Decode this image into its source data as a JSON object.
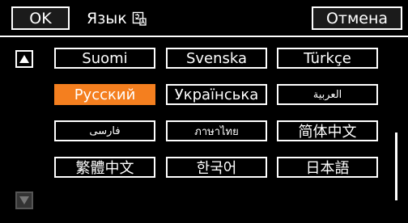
{
  "header": {
    "ok_label": "OK",
    "title": "Язык",
    "title_icon": "language-book-icon",
    "cancel_label": "Отмена"
  },
  "scroll": {
    "up_icon": "scroll-up-arrow-icon",
    "down_icon": "scroll-down-arrow-icon",
    "position": 1.0
  },
  "languages": [
    {
      "label": "Suomi",
      "selected": false
    },
    {
      "label": "Svenska",
      "selected": false
    },
    {
      "label": "Türkçe",
      "selected": false
    },
    {
      "label": "Русский",
      "selected": true
    },
    {
      "label": "Українська",
      "selected": false
    },
    {
      "label": "العربية",
      "selected": false
    },
    {
      "label": "فارسی",
      "selected": false
    },
    {
      "label": "ภาษาไทย",
      "selected": false
    },
    {
      "label": "简体中文",
      "selected": false
    },
    {
      "label": "繁體中文",
      "selected": false
    },
    {
      "label": "한국어",
      "selected": false
    },
    {
      "label": "日本語",
      "selected": false
    }
  ],
  "colors": {
    "background": "#000000",
    "border": "#ffffff",
    "selected": "#f47f1f",
    "disabled_arrow": "#555555"
  }
}
